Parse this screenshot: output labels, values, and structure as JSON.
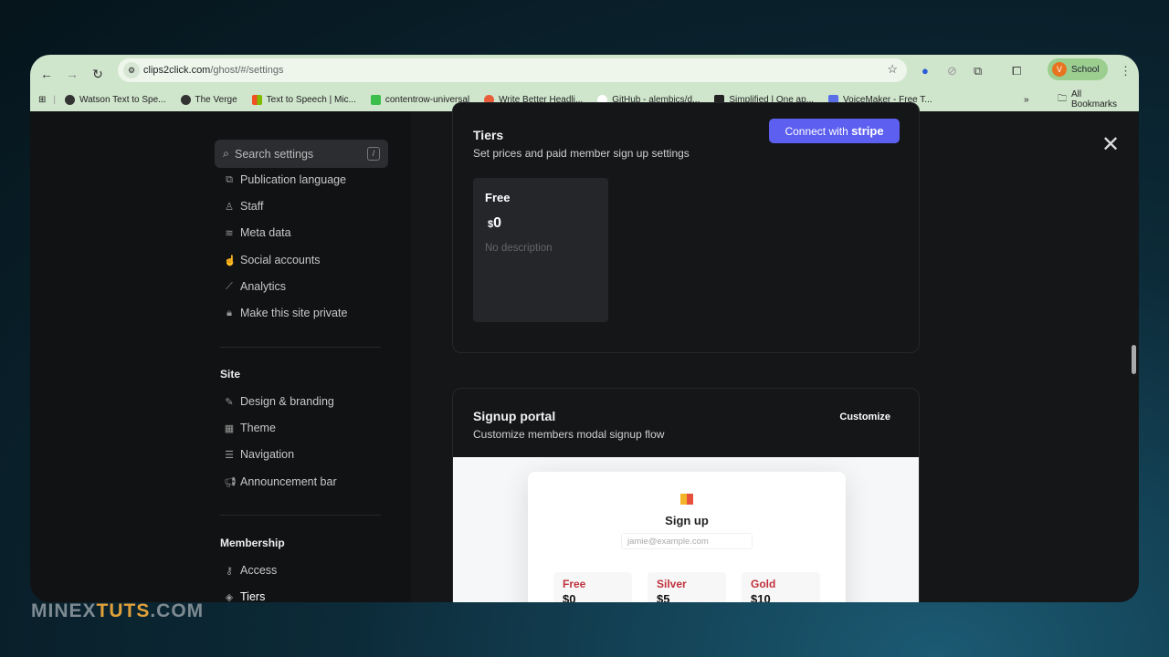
{
  "browser": {
    "url_host": "clips2click.com",
    "url_path": "/ghost/#/settings",
    "profile_initial": "V",
    "profile_name": "School",
    "bookmarks": [
      "Watson Text to Spe...",
      "The Verge",
      "Text to Speech | Mic...",
      "contentrow-universal",
      "Write Better Headli...",
      "GitHub - alembics/d...",
      "Simplified | One ap...",
      "VoiceMaker - Free T..."
    ],
    "all_bookmarks": "All Bookmarks",
    "overflow": "»"
  },
  "sidebar": {
    "search_placeholder": "Search settings",
    "search_shortcut": "/",
    "general_items": [
      "Publication language",
      "Staff",
      "Meta data",
      "Social accounts",
      "Analytics",
      "Make this site private"
    ],
    "site_title": "Site",
    "site_items": [
      "Design & branding",
      "Theme",
      "Navigation",
      "Announcement bar"
    ],
    "membership_title": "Membership",
    "membership_items": [
      "Access",
      "Tiers"
    ]
  },
  "tiers": {
    "title": "Tiers",
    "subtitle": "Set prices and paid member sign up settings",
    "connect_label": "Connect with",
    "connect_brand": "stripe",
    "tier": {
      "name": "Free",
      "currency": "$",
      "price": "0",
      "description": "No description"
    }
  },
  "signup_portal": {
    "title": "Signup portal",
    "subtitle": "Customize members modal signup flow",
    "customize": "Customize",
    "preview": {
      "title": "Sign up",
      "email_placeholder": "jamie@example.com",
      "plans": [
        {
          "name": "Free",
          "price": "$0"
        },
        {
          "name": "Silver",
          "price": "$5"
        },
        {
          "name": "Gold",
          "price": "$10"
        }
      ]
    }
  },
  "watermark": {
    "part1": "MINEX",
    "part2": "TUTS",
    "part3": ".COM"
  }
}
